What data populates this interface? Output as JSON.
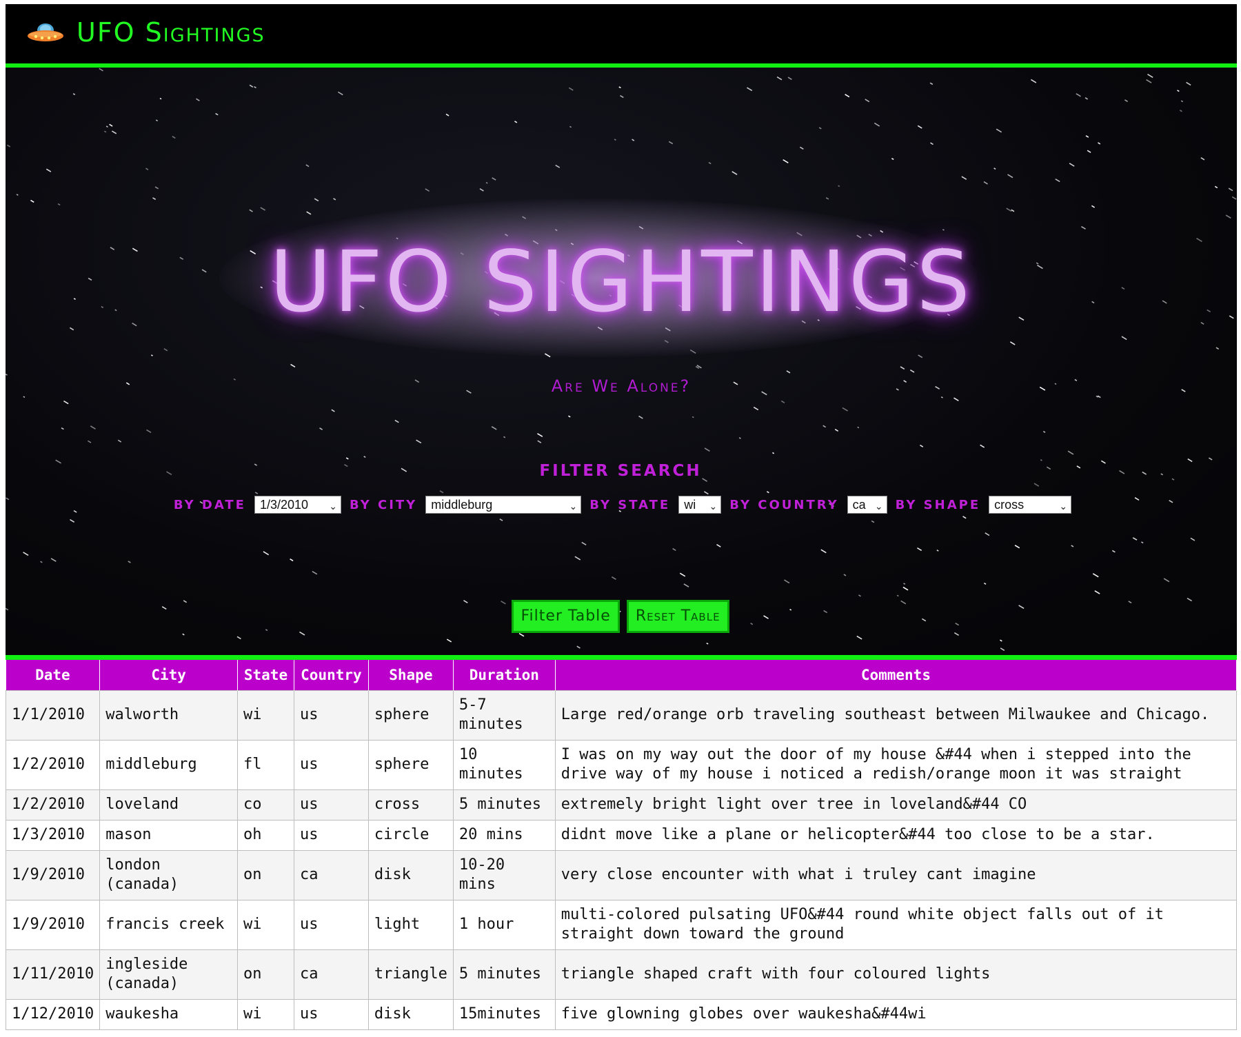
{
  "navbar": {
    "brand": "UFO Sightings",
    "icon": "ufo-icon"
  },
  "hero": {
    "title": "UFO SIGHTINGS",
    "subtitle": "Are We Alone?"
  },
  "filters": {
    "title": "FILTER SEARCH",
    "date_label": "by date",
    "date_value": "1/3/2010",
    "city_label": "by city",
    "city_value": "middleburg",
    "state_label": "by state",
    "state_value": "wi",
    "country_label": "by country",
    "country_value": "ca",
    "shape_label": "by shape",
    "shape_value": "cross",
    "filter_button": "Filter Table",
    "reset_button": "Reset Table"
  },
  "table": {
    "headers": [
      "Date",
      "City",
      "State",
      "Country",
      "Shape",
      "Duration",
      "Comments"
    ],
    "rows": [
      [
        "1/1/2010",
        "walworth",
        "wi",
        "us",
        "sphere",
        "5-7 minutes",
        "Large red/orange orb traveling southeast between Milwaukee and Chicago."
      ],
      [
        "1/2/2010",
        "middleburg",
        "fl",
        "us",
        "sphere",
        "10 minutes",
        "I was on my way out the door of my house &#44 when i stepped into the drive way of my house i noticed a redish/orange moon it was straight"
      ],
      [
        "1/2/2010",
        "loveland",
        "co",
        "us",
        "cross",
        "5 minutes",
        "extremely bright light over tree in loveland&#44 CO"
      ],
      [
        "1/3/2010",
        "mason",
        "oh",
        "us",
        "circle",
        "20 mins",
        "didnt move like a plane or helicopter&#44 too close to be a star."
      ],
      [
        "1/9/2010",
        "london (canada)",
        "on",
        "ca",
        "disk",
        "10-20 mins",
        "very close encounter with what i truley cant imagine"
      ],
      [
        "1/9/2010",
        "francis creek",
        "wi",
        "us",
        "light",
        "1 hour",
        "multi-colored pulsating UFO&#44 round white object falls out of it straight down toward the ground"
      ],
      [
        "1/11/2010",
        "ingleside (canada)",
        "on",
        "ca",
        "triangle",
        "5 minutes",
        "triangle shaped craft with four coloured lights"
      ],
      [
        "1/12/2010",
        "waukesha",
        "wi",
        "us",
        "disk",
        "15minutes",
        "five glowning globes over waukesha&#44wi"
      ]
    ]
  },
  "colors": {
    "accent_green": "#11ee11",
    "header_purple": "#bb00cc",
    "label_purple": "#c020d8",
    "title_glow": "#e2b6f0"
  }
}
